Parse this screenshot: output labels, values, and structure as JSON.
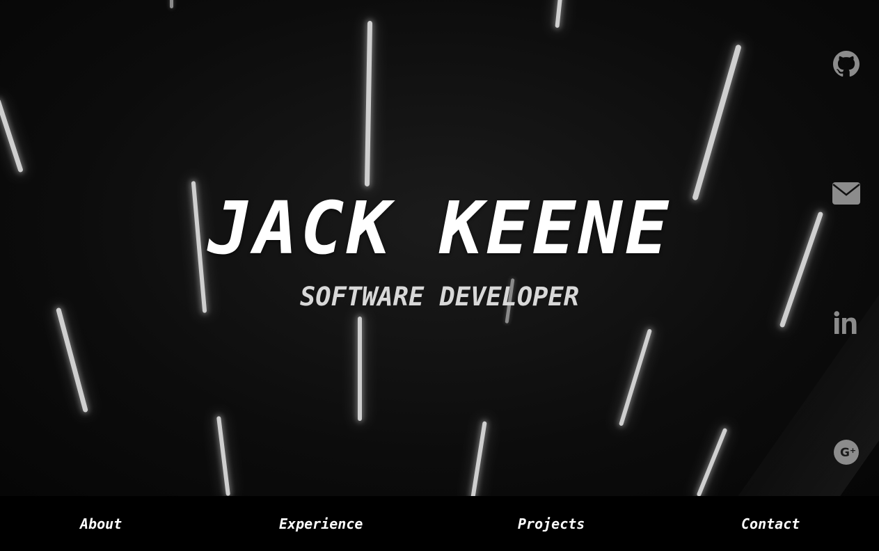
{
  "hero": {
    "name": "JACK KEENE",
    "title": "SOFTWARE DEVELOPER"
  },
  "social": [
    {
      "icon": "github-icon"
    },
    {
      "icon": "envelope-icon"
    },
    {
      "icon": "linkedin-icon"
    },
    {
      "icon": "google-plus-icon"
    }
  ],
  "nav": {
    "about": "About",
    "experience": "Experience",
    "projects": "Projects",
    "contact": "Contact"
  },
  "colors": {
    "background": "#000000",
    "text": "#ffffff",
    "subtitle": "#d8d8d8",
    "icon": "#8c8c8c"
  }
}
